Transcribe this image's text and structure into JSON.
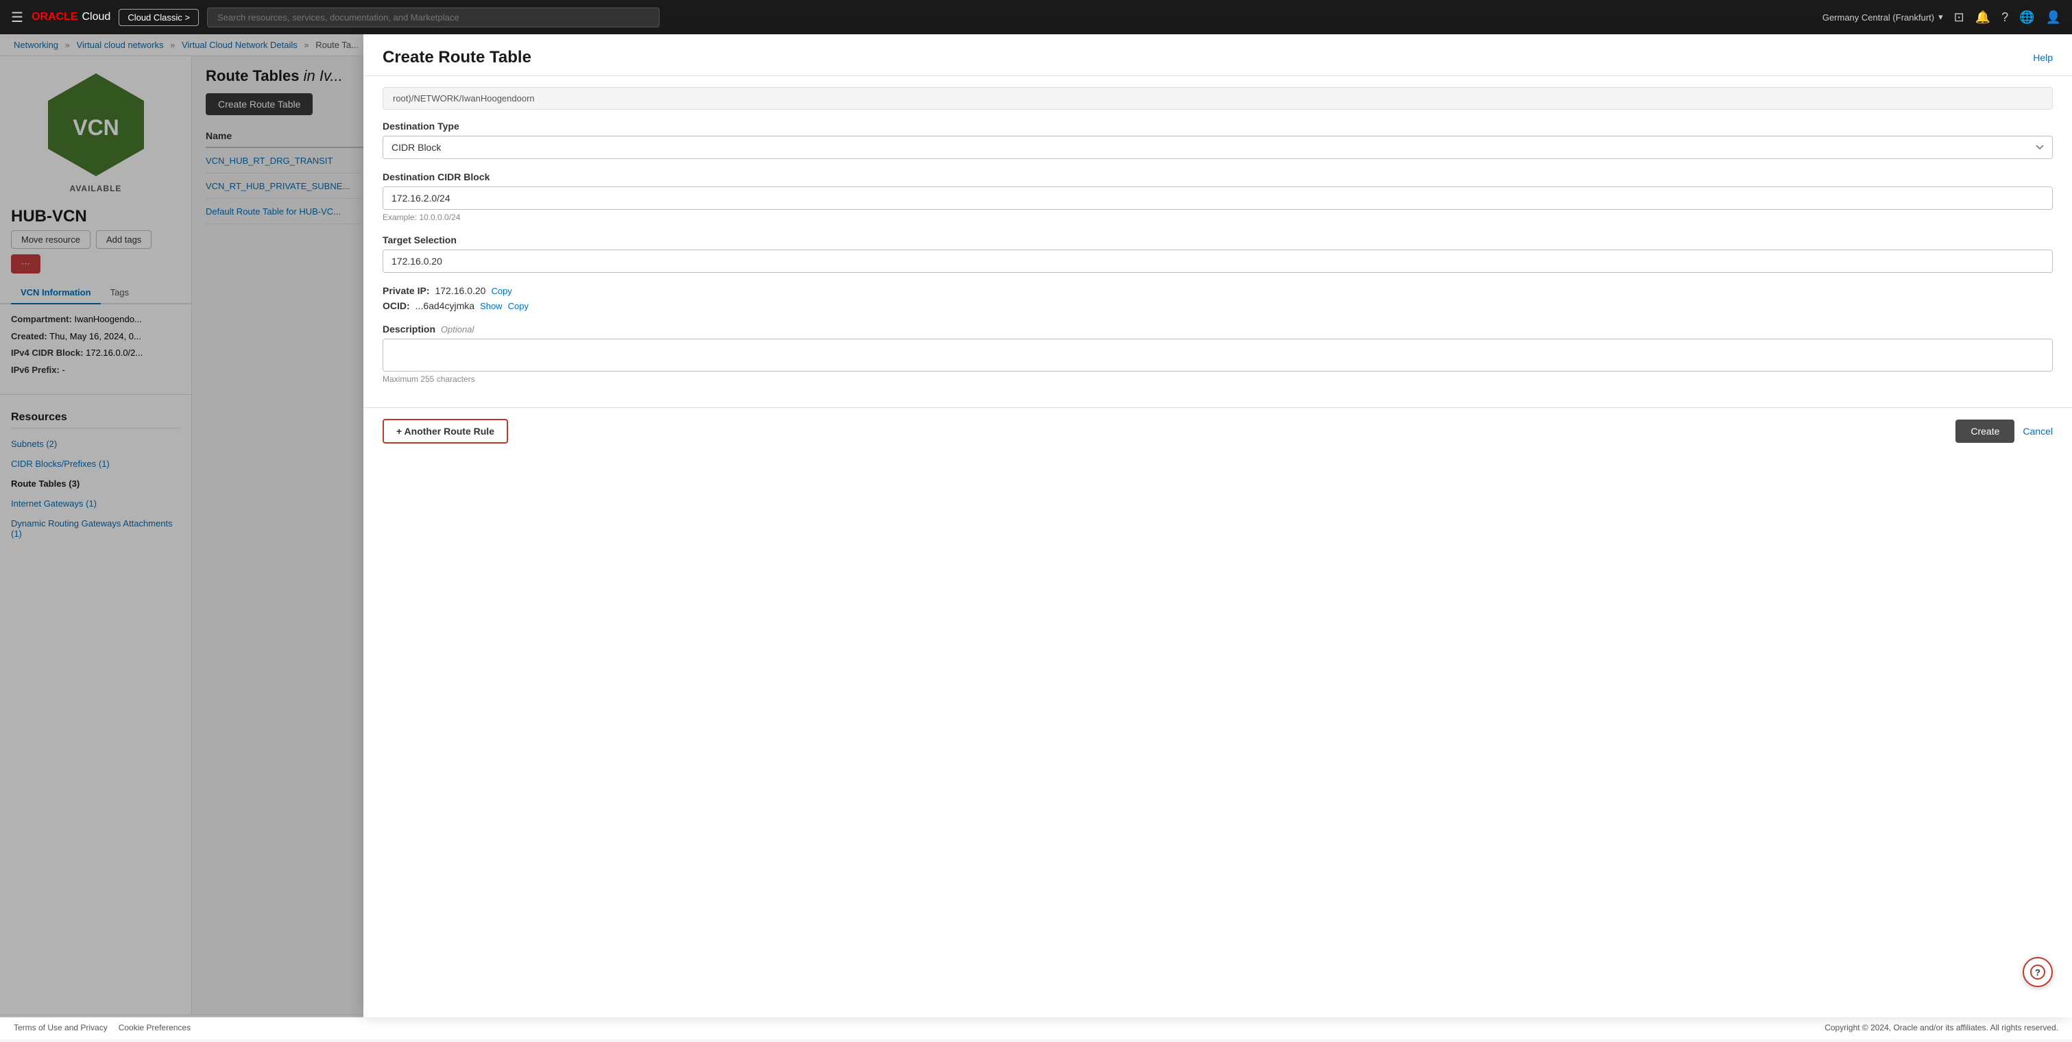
{
  "topnav": {
    "hamburger": "☰",
    "oracle_label": "ORACLE",
    "cloud_label": "Cloud",
    "cloud_classic_btn": "Cloud Classic >",
    "search_placeholder": "Search resources, services, documentation, and Marketplace",
    "region": "Germany Central (Frankfurt)",
    "chevron": "▾"
  },
  "breadcrumb": {
    "networking": "Networking",
    "vcn_list": "Virtual cloud networks",
    "vcn_detail": "Virtual Cloud Network Details",
    "route_tables": "Route Ta..."
  },
  "sidebar": {
    "vcn_name": "HUB-VCN",
    "vcn_status": "AVAILABLE",
    "move_resource_btn": "Move resource",
    "add_tags_btn": "Add tags",
    "tabs": [
      {
        "label": "VCN Information",
        "active": true
      },
      {
        "label": "Tags",
        "active": false
      }
    ],
    "compartment_label": "Compartment:",
    "compartment_value": "IwanHoogendo...",
    "created_label": "Created:",
    "created_value": "Thu, May 16, 2024, 0...",
    "ipv4_label": "IPv4 CIDR Block:",
    "ipv4_value": "172.16.0.0/2...",
    "ipv6_label": "IPv6 Prefix:",
    "ipv6_value": "-",
    "resources_title": "Resources",
    "resource_links": [
      {
        "label": "Subnets (2)",
        "active": false
      },
      {
        "label": "CIDR Blocks/Prefixes (1)",
        "active": false
      },
      {
        "label": "Route Tables (3)",
        "active": true
      },
      {
        "label": "Internet Gateways (1)",
        "active": false
      },
      {
        "label": "Dynamic Routing Gateways Attachments (1)",
        "active": false
      }
    ]
  },
  "main": {
    "route_tables_title": "Route Tables",
    "route_tables_in": "in Iv...",
    "create_btn": "Create Route Table",
    "table_col_name": "Name",
    "table_rows": [
      {
        "name": "VCN_HUB_RT_DRG_TRANSIT"
      },
      {
        "name": "VCN_RT_HUB_PRIVATE_SUBNE..."
      },
      {
        "name": "Default Route Table for HUB-VC..."
      }
    ]
  },
  "modal": {
    "title": "Create Route Table",
    "help_label": "Help",
    "compartment_path": "root)/NETWORK/IwanHoogendoorn",
    "destination_type_label": "Destination Type",
    "destination_type_value": "CIDR Block",
    "destination_cidr_label": "Destination CIDR Block",
    "destination_cidr_value": "172.16.2.0/24",
    "destination_cidr_hint": "Example: 10.0.0.0/24",
    "target_selection_label": "Target Selection",
    "target_selection_value": "172.16.0.20",
    "private_ip_label": "Private IP:",
    "private_ip_value": "172.16.0.20",
    "private_ip_copy": "Copy",
    "ocid_label": "OCID:",
    "ocid_value": "...6ad4cyjmka",
    "ocid_show": "Show",
    "ocid_copy": "Copy",
    "description_label": "Description",
    "description_optional": "Optional",
    "description_placeholder": "",
    "description_hint": "Maximum 255 characters",
    "another_route_rule_btn": "+ Another Route Rule",
    "create_btn": "Create",
    "cancel_btn": "Cancel"
  },
  "footer": {
    "terms": "Terms of Use and Privacy",
    "cookie": "Cookie Preferences",
    "copyright": "Copyright © 2024, Oracle and/or its affiliates. All rights reserved."
  }
}
